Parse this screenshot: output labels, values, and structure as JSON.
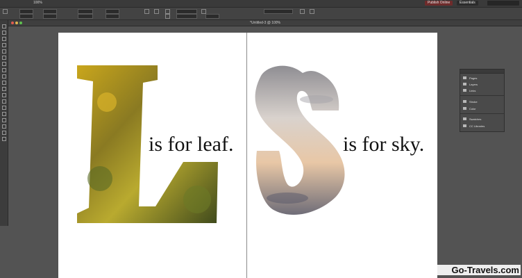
{
  "app": {
    "zoom_display": "100%",
    "workspaces": [
      "Publish Online",
      "Essentials"
    ],
    "document_title": "*Untitled-3 @ 100%"
  },
  "icons": {
    "tools": [
      "selection-tool-icon",
      "direct-selection-tool-icon",
      "page-tool-icon",
      "gap-tool-icon",
      "type-tool-icon",
      "line-tool-icon",
      "pen-tool-icon",
      "pencil-tool-icon",
      "rectangle-frame-tool-icon",
      "rectangle-tool-icon",
      "scissors-tool-icon",
      "free-transform-tool-icon",
      "gradient-swatch-tool-icon",
      "note-tool-icon",
      "eyedropper-tool-icon",
      "hand-tool-icon",
      "zoom-tool-icon",
      "fill-stroke-icon",
      "screen-mode-icon"
    ]
  },
  "spread": {
    "left_page": {
      "big_letter": "L",
      "caption": "is for leaf."
    },
    "right_page": {
      "big_letter": "S",
      "caption": "is for sky."
    }
  },
  "panels": {
    "items": [
      {
        "label": "Pages",
        "icon": "pages-icon"
      },
      {
        "label": "Layers",
        "icon": "layers-icon"
      },
      {
        "label": "Links",
        "icon": "links-icon"
      },
      {
        "label": "Stroke",
        "icon": "stroke-icon"
      },
      {
        "label": "Color",
        "icon": "color-icon"
      },
      {
        "label": "Swatches",
        "icon": "swatches-icon"
      },
      {
        "label": "CC Libraries",
        "icon": "cc-libraries-icon"
      }
    ]
  },
  "watermark": "Go-Travels.com",
  "colors": {
    "app_bg": "#535353",
    "page_bg": "#ffffff",
    "publish_button": "#6e2b2b"
  }
}
